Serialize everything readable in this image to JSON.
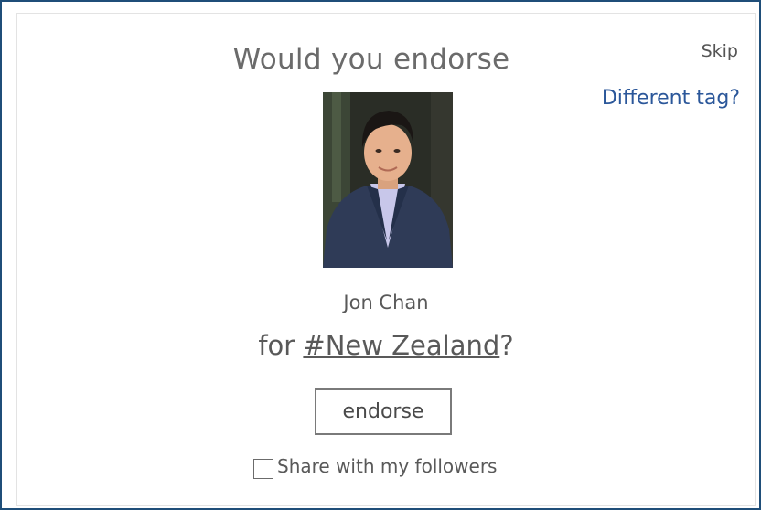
{
  "prompt": {
    "title": "Would you endorse",
    "skip_label": "Skip",
    "different_tag_label": "Different tag?"
  },
  "profile": {
    "name": "Jon Chan",
    "photo_icon": "profile-photo"
  },
  "tag_line": {
    "prefix": "for ",
    "tag": "#New Zealand",
    "suffix": "?"
  },
  "actions": {
    "endorse_label": "endorse",
    "share_label": "Share with my followers",
    "share_checked": false
  },
  "colors": {
    "frame_border": "#1f4e79",
    "link_blue": "#2b579a",
    "text_gray": "#595959"
  }
}
